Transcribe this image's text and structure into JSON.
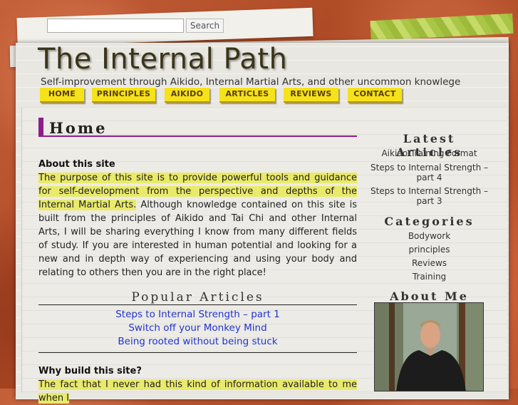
{
  "search": {
    "placeholder": "",
    "button_label": "Search"
  },
  "header": {
    "title": "The Internal Path",
    "tagline": "Self-improvement through Aikido, Internal Martial Arts, and other uncommon knowlege"
  },
  "nav": [
    "HOME",
    "PRINCIPLES",
    "AIKIDO",
    "ARTICLES",
    "REVIEWS",
    "CONTACT"
  ],
  "main": {
    "heading": "Home",
    "about_title": "About this site",
    "about_highlight": "The purpose of this site is to provide powerful tools and guidance for self-development from the perspective and depths of the Internal Martial Arts.",
    "about_rest": " Although knowledge contained on this site is built from the principles of Aikido and Tai Chi and other Internal Arts, I will be sharing everything I know from many different fields of study. If you are interested in human potential and looking for a new and in depth way of experiencing and using your body and relating to others then you are in the right place!",
    "popular_title": "Popular Articles",
    "popular_links": [
      "Steps to Internal Strength – part 1",
      "Switch off your Monkey Mind",
      "Being rooted without being stuck"
    ],
    "why_title": "Why build this site?",
    "why_text": "The fact that I never had this kind of information available to me when I"
  },
  "sidebar": {
    "latest_title": "Latest Articles",
    "latest": [
      "Aikido Training Format",
      "Steps to Internal Strength – part 4",
      "Steps to Internal Strength – part 3"
    ],
    "categories_title": "Categories",
    "categories": [
      "Bodywork",
      "principles",
      "Reviews",
      "Training"
    ],
    "about_title": "About Me"
  },
  "colors": {
    "nav_bg": "#f5e21a",
    "heading_accent": "#8c1e8c",
    "highlight": "#e9ea6a",
    "link": "#2233cc",
    "background": "#b8502e"
  }
}
